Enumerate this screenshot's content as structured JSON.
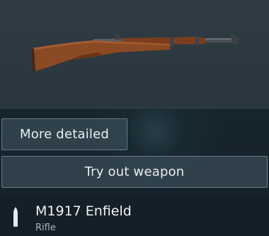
{
  "buttons": {
    "more_detailed": "More detailed",
    "try_out": "Try out weapon"
  },
  "weapon": {
    "name": "M1917 Enfield",
    "class": "Rifle",
    "preview_icon": "rifle-model",
    "ammo_icon": "bullet-icon"
  },
  "colors": {
    "preview_bg": "#2f3c44",
    "button_bg": "#465a64",
    "text_primary": "#f0f4f5",
    "text_secondary": "#a9b6bc"
  }
}
